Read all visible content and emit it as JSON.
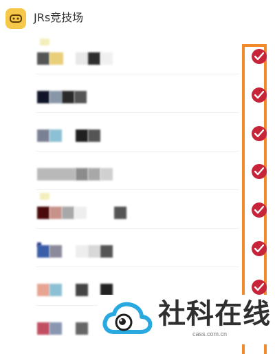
{
  "header": {
    "title": "JRs竞技场",
    "icon": "gamepad-icon"
  },
  "rows": [
    {
      "checked": true,
      "check_icon": "checkmark-icon"
    },
    {
      "checked": true,
      "check_icon": "checkmark-icon"
    },
    {
      "checked": true,
      "check_icon": "checkmark-icon"
    },
    {
      "checked": true,
      "check_icon": "checkmark-icon"
    },
    {
      "checked": true,
      "check_icon": "checkmark-icon"
    },
    {
      "checked": true,
      "check_icon": "checkmark-icon"
    },
    {
      "checked": true,
      "check_icon": "checkmark-icon"
    },
    {
      "checked": true,
      "check_icon": "checkmark-icon"
    }
  ],
  "watermark": {
    "text": "社科在线",
    "url": "cass.com.cn",
    "logo": "cloud-eye-logo"
  },
  "colors": {
    "accent": "#f6c84a",
    "check": "#c7243a",
    "highlight": "#f08a2b"
  }
}
